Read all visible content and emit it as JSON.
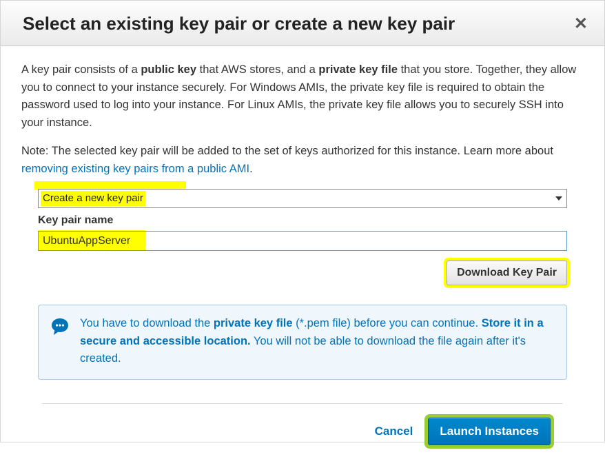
{
  "header": {
    "title": "Select an existing key pair or create a new key pair"
  },
  "body": {
    "para1_a": "A key pair consists of a ",
    "para1_b": "public key",
    "para1_c": " that AWS stores, and a ",
    "para1_d": "private key file",
    "para1_e": " that you store. Together, they allow you to connect to your instance securely. For Windows AMIs, the private key file is required to obtain the password used to log into your instance. For Linux AMIs, the private key file allows you to securely SSH into your instance.",
    "note_a": "Note: The selected key pair will be added to the set of keys authorized for this instance. Learn more about ",
    "note_link": "removing existing key pairs from a public AMI",
    "note_dot": "."
  },
  "form": {
    "select_value": "Create a new key pair",
    "keypair_label": "Key pair name",
    "keypair_value": "UbuntuAppServer",
    "download_label": "Download Key Pair"
  },
  "info": {
    "t1": "You have to download the ",
    "t2": "private key file",
    "t3": " (*.pem file) before you can continue. ",
    "t4": "Store it in a secure and accessible location.",
    "t5": " You will not be able to download the file again after it's created."
  },
  "footer": {
    "cancel": "Cancel",
    "launch": "Launch Instances"
  }
}
